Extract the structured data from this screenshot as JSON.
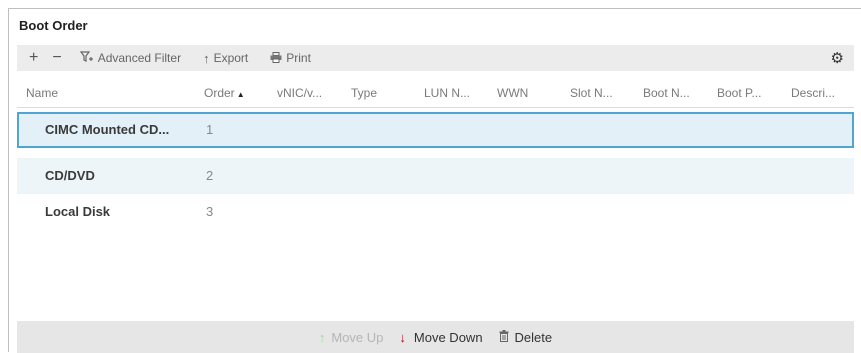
{
  "panel": {
    "title": "Boot Order"
  },
  "toolbar": {
    "add_icon": "+",
    "remove_icon": "−",
    "advanced_filter_label": "Advanced Filter",
    "export_label": "Export",
    "print_label": "Print"
  },
  "columns": [
    "Name",
    "Order",
    "vNIC/v...",
    "Type",
    "LUN N...",
    "WWN",
    "Slot N...",
    "Boot N...",
    "Boot P...",
    "Descri..."
  ],
  "sort_indicator": "▲",
  "rows": [
    {
      "name": "CIMC Mounted CD...",
      "order": "1"
    },
    {
      "name": "CD/DVD",
      "order": "2"
    },
    {
      "name": "Local Disk",
      "order": "3"
    }
  ],
  "footer": {
    "move_up_label": "Move Up",
    "move_down_label": "Move Down",
    "delete_label": "Delete"
  },
  "colors": {
    "selection_border": "#4fa7d1",
    "selection_fill": "#e3f0f7",
    "move_down_icon": "#d0021b"
  }
}
